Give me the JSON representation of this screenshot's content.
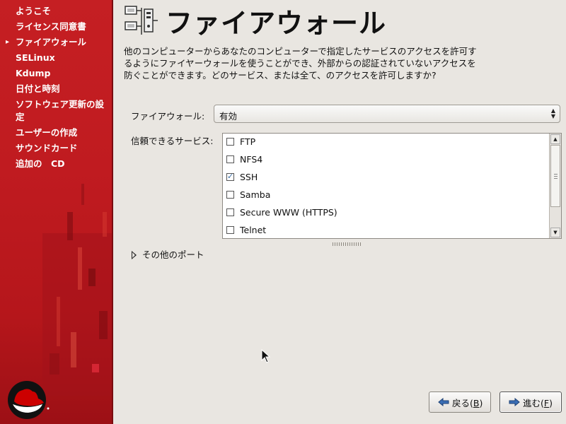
{
  "sidebar": {
    "steps": [
      {
        "label": "ようこそ",
        "current": false
      },
      {
        "label": "ライセンス同意書",
        "current": false
      },
      {
        "label": "ファイアウォール",
        "current": true
      },
      {
        "label": "SELinux",
        "current": false
      },
      {
        "label": "Kdump",
        "current": false
      },
      {
        "label": "日付と時刻",
        "current": false
      },
      {
        "label": "ソフトウェア更新の設定",
        "current": false
      },
      {
        "label": "ユーザーの作成",
        "current": false
      },
      {
        "label": "サウンドカード",
        "current": false
      },
      {
        "label": "追加の　CD",
        "current": false
      }
    ],
    "current_marker": "▸"
  },
  "header": {
    "title": "ファイアウォール",
    "icon": "firewall-network-icon"
  },
  "description": "他のコンピューターからあなたのコンピューターで指定したサービスのアクセスを許可するようにファイヤーウォールを使うことができ、外部からの認証されていないアクセスを防ぐことができます。どのサービス、または全て、のアクセスを許可しますか?",
  "firewall": {
    "label": "ファイアウォール:",
    "value": "有効"
  },
  "services": {
    "label": "信頼できるサービス:",
    "items": [
      {
        "label": "FTP",
        "checked": false
      },
      {
        "label": "NFS4",
        "checked": false
      },
      {
        "label": "SSH",
        "checked": true
      },
      {
        "label": "Samba",
        "checked": false
      },
      {
        "label": "Secure WWW (HTTPS)",
        "checked": false
      },
      {
        "label": "Telnet",
        "checked": false
      }
    ]
  },
  "other_ports": {
    "label": "その他のポート"
  },
  "buttons": {
    "back": {
      "label": "戻る(",
      "mnemonic": "B",
      "suffix": ")"
    },
    "next": {
      "label": "進む(",
      "mnemonic": "F",
      "suffix": ")"
    }
  },
  "colors": {
    "sidebar_red": "#c01b20",
    "background": "#e9e6e1"
  }
}
